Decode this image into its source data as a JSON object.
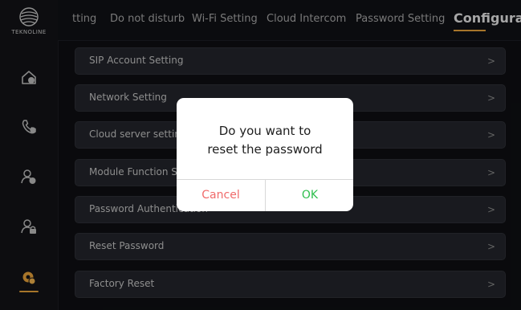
{
  "brand": {
    "name": "TEKNOLINE"
  },
  "tabs": [
    {
      "label": "tting"
    },
    {
      "label": "Do not disturb"
    },
    {
      "label": "Wi-Fi Setting"
    },
    {
      "label": "Cloud Intercom"
    },
    {
      "label": "Password Setting"
    },
    {
      "label": "Configurat",
      "active": true
    }
  ],
  "sidebar": {
    "icons": [
      "home-icon",
      "phone-icon",
      "user-settings-icon",
      "user-lock-icon",
      "gear-settings-icon"
    ],
    "active_index": 4
  },
  "settings": [
    {
      "label": "SIP Account Setting",
      "chevron": ">"
    },
    {
      "label": "Network Setting",
      "chevron": ">"
    },
    {
      "label": "Cloud server setting",
      "chevron": ">"
    },
    {
      "label": "Module Function Se",
      "chevron": ">"
    },
    {
      "label": "Password Authentication",
      "chevron": ">"
    },
    {
      "label": "Reset Password",
      "chevron": ">"
    },
    {
      "label": "Factory Reset",
      "chevron": ">"
    }
  ],
  "dialog": {
    "line1": "Do you want to",
    "line2": "reset the password",
    "cancel_label": "Cancel",
    "ok_label": "OK"
  },
  "colors": {
    "accent": "#e8a23b",
    "cancel": "#f06a6a",
    "ok": "#2fbf4e"
  }
}
